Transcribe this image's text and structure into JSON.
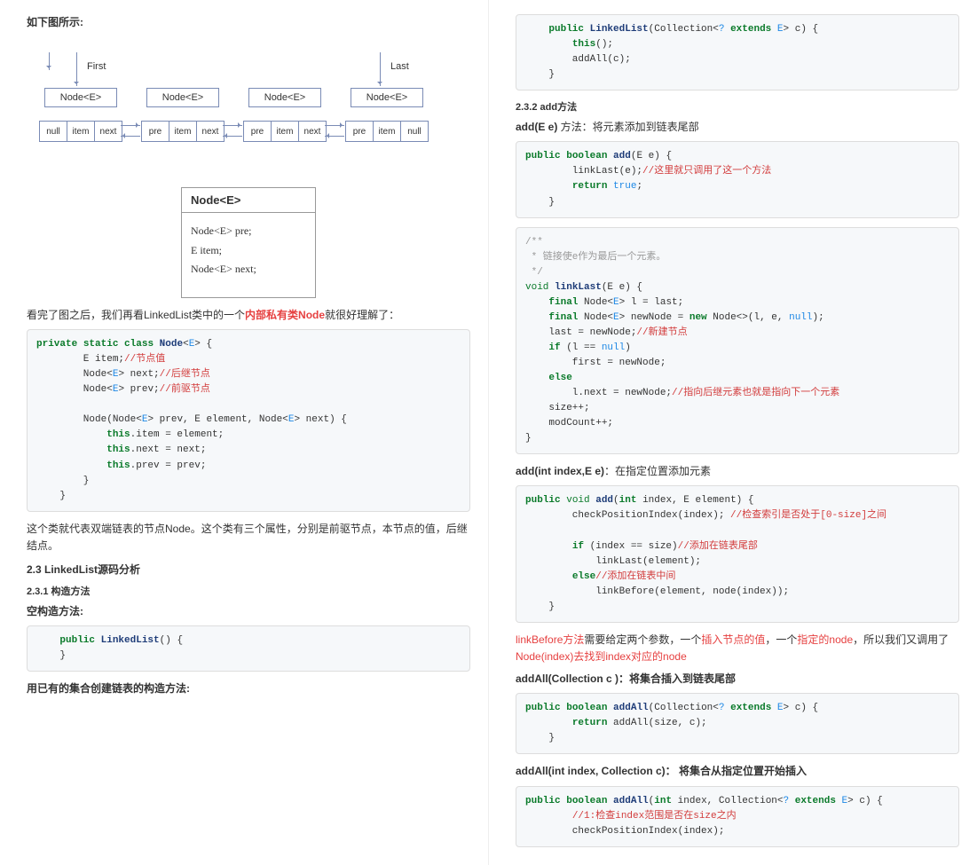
{
  "left": {
    "intro": "如下图所示:",
    "d1": {
      "first": "First",
      "last": "Last",
      "node": "Node<E>",
      "cell_null": "null",
      "cell_item": "item",
      "cell_next": "next",
      "cell_pre": "pre"
    },
    "d2": {
      "title": "Node<E>",
      "l1": "Node<E> pre;",
      "l2": "E item;",
      "l3": "Node<E> next;"
    },
    "afterDiagram_a": "看完了图之后，我们再看LinkedList类中的一个",
    "afterDiagram_red": "内部私有类Node",
    "afterDiagram_b": "就很好理解了：",
    "nodeClassSummary": "这个类就代表双端链表的节点Node。这个类有三个属性，分别是前驱节点，本节点的值，后继结点。",
    "h23": "2.3 LinkedList源码分析",
    "h231": "2.3.1 构造方法",
    "emptyCtor": "空构造方法:",
    "fromCollCtor": "用已有的集合创建链表的构造方法:"
  },
  "right": {
    "h232": "2.3.2 add方法",
    "addE_a": "add(E e)",
    "addE_b": " 方法：将元素添加到链表尾部",
    "addIdx_a": "add(int index,E e)",
    "addIdx_b": "：在指定位置添加元素",
    "linkBefore_a": "linkBefore方法",
    "linkBefore_b": "需要给定两个参数，一个",
    "linkBefore_c": "插入节点的值",
    "linkBefore_d": "，一个",
    "linkBefore_e": "指定的node",
    "linkBefore_f": "，所以我们又调用了",
    "linkBefore_g": "Node(index)去找到index对应的node",
    "addAll_a": "addAll(Collection  c )：将集合插入到链表尾部",
    "addAllIdx_a": "addAll(int index, Collection c)： 将集合从指定位置开始插入"
  }
}
